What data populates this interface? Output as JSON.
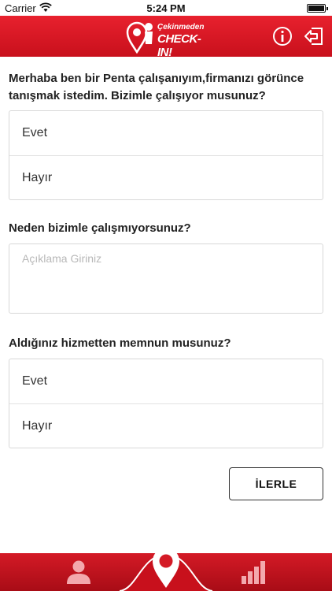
{
  "status_bar": {
    "carrier": "Carrier",
    "time": "5:24 PM"
  },
  "header": {
    "logo_line1": "Çekinmeden",
    "logo_line2": "CHECK-IN!"
  },
  "form": {
    "question1": "Merhaba ben bir Penta çalışanıyım,firmanızı görünce tanışmak istedim.   Bizimle çalışıyor musunuz?",
    "question1_options": [
      "Evet",
      "Hayır"
    ],
    "question2": "Neden bizimle çalışmıyorsunuz?",
    "question2_placeholder": "Açıklama Giriniz",
    "question3": "Aldığınız hizmetten memnun musunuz?",
    "question3_options": [
      "Evet",
      "Hayır"
    ],
    "next_label": "İLERLE"
  },
  "colors": {
    "brand_red": "#d81e2a"
  },
  "icons": {
    "header": [
      "info-icon",
      "logout-icon"
    ],
    "tabs": [
      "profile-icon",
      "checkin-pin-icon",
      "stats-icon"
    ]
  }
}
